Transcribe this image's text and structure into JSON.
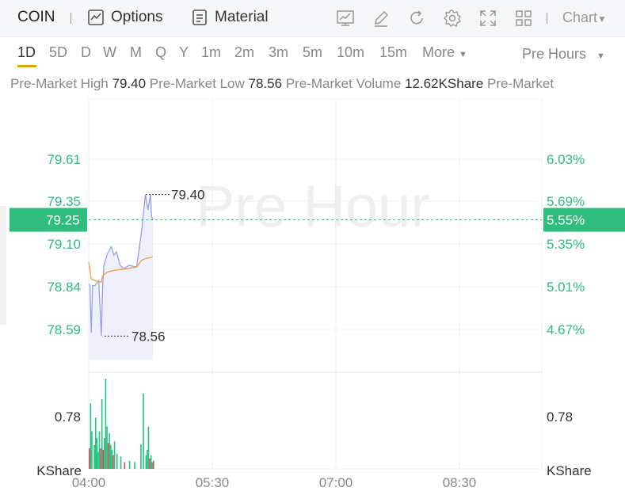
{
  "toolbar": {
    "ticker": "COIN",
    "options_label": "Options",
    "material_label": "Material",
    "chart_select_label": "Chart",
    "icons": [
      "indicator-icon",
      "draw-icon",
      "refresh-icon",
      "settings-icon",
      "fullscreen-icon",
      "layout-icon"
    ]
  },
  "periods": {
    "items": [
      "1D",
      "5D",
      "D",
      "W",
      "M",
      "Q",
      "Y",
      "1m",
      "2m",
      "3m",
      "5m",
      "10m",
      "15m",
      "More"
    ],
    "active": "1D",
    "hours_select": "Pre Hours"
  },
  "stats": [
    {
      "label": "Pre-Market High",
      "value": "79.40"
    },
    {
      "label": "Pre-Market Low",
      "value": "78.56"
    },
    {
      "label": "Pre-Market Volume",
      "value": "12.62KShare"
    },
    {
      "label": "Pre-Market",
      "value": ""
    }
  ],
  "chart_data": {
    "type": "line",
    "watermark": "Pre Hour",
    "x_ticks": [
      "04:00",
      "05:30",
      "07:00",
      "08:30"
    ],
    "price_ticks": [
      "79.61",
      "79.35",
      "79.10",
      "78.84",
      "78.59"
    ],
    "pct_ticks": [
      "6.03%",
      "5.69%",
      "5.35%",
      "5.01%",
      "4.67%"
    ],
    "current_price": "79.25",
    "current_pct": "5.55%",
    "high_label": "79.40",
    "low_label": "78.56",
    "volume_tick": "0.78",
    "volume_unit": "KShare",
    "price_series": [
      {
        "t": "04:00",
        "v": 78.87
      },
      {
        "t": "04:01",
        "v": 78.86
      },
      {
        "t": "04:02",
        "v": 78.58
      },
      {
        "t": "04:03",
        "v": 78.86
      },
      {
        "t": "04:05",
        "v": 78.86
      },
      {
        "t": "04:08",
        "v": 78.89
      },
      {
        "t": "04:10",
        "v": 78.56
      },
      {
        "t": "04:11",
        "v": 78.84
      },
      {
        "t": "04:12",
        "v": 78.98
      },
      {
        "t": "04:15",
        "v": 79.05
      },
      {
        "t": "04:18",
        "v": 79.09
      },
      {
        "t": "04:20",
        "v": 79.04
      },
      {
        "t": "04:22",
        "v": 79.06
      },
      {
        "t": "04:25",
        "v": 78.98
      },
      {
        "t": "04:28",
        "v": 78.96
      },
      {
        "t": "04:32",
        "v": 78.98
      },
      {
        "t": "04:38",
        "v": 78.97
      },
      {
        "t": "04:42",
        "v": 79.18
      },
      {
        "t": "04:45",
        "v": 79.4
      },
      {
        "t": "04:47",
        "v": 79.31
      },
      {
        "t": "04:49",
        "v": 79.4
      },
      {
        "t": "04:50",
        "v": 79.27
      },
      {
        "t": "04:51",
        "v": 79.25
      }
    ],
    "avg_series": [
      {
        "t": "04:00",
        "v": 79.0
      },
      {
        "t": "04:02",
        "v": 78.9
      },
      {
        "t": "04:05",
        "v": 78.89
      },
      {
        "t": "04:10",
        "v": 78.88
      },
      {
        "t": "04:11",
        "v": 78.92
      },
      {
        "t": "04:15",
        "v": 78.94
      },
      {
        "t": "04:20",
        "v": 78.95
      },
      {
        "t": "04:30",
        "v": 78.96
      },
      {
        "t": "04:38",
        "v": 78.97
      },
      {
        "t": "04:42",
        "v": 79.01
      },
      {
        "t": "04:45",
        "v": 79.02
      },
      {
        "t": "04:51",
        "v": 79.03
      }
    ],
    "volume_series": [
      {
        "t": "04:00",
        "v": 0.3,
        "dir": "down"
      },
      {
        "t": "04:01",
        "v": 0.96,
        "dir": "up"
      },
      {
        "t": "04:02",
        "v": 0.55,
        "dir": "up"
      },
      {
        "t": "04:04",
        "v": 0.35,
        "dir": "up"
      },
      {
        "t": "04:05",
        "v": 0.75,
        "dir": "up"
      },
      {
        "t": "04:06",
        "v": 0.45,
        "dir": "up"
      },
      {
        "t": "04:07",
        "v": 0.25,
        "dir": "up"
      },
      {
        "t": "04:08",
        "v": 0.55,
        "dir": "up"
      },
      {
        "t": "04:09",
        "v": 0.3,
        "dir": "down"
      },
      {
        "t": "04:10",
        "v": 1.02,
        "dir": "up"
      },
      {
        "t": "04:11",
        "v": 0.28,
        "dir": "down"
      },
      {
        "t": "04:12",
        "v": 0.45,
        "dir": "up"
      },
      {
        "t": "04:13",
        "v": 1.32,
        "dir": "up"
      },
      {
        "t": "04:14",
        "v": 0.62,
        "dir": "up"
      },
      {
        "t": "04:15",
        "v": 0.38,
        "dir": "down"
      },
      {
        "t": "04:16",
        "v": 0.52,
        "dir": "up"
      },
      {
        "t": "04:17",
        "v": 0.35,
        "dir": "up"
      },
      {
        "t": "04:18",
        "v": 0.28,
        "dir": "up"
      },
      {
        "t": "04:19",
        "v": 0.2,
        "dir": "down"
      },
      {
        "t": "04:20",
        "v": 0.4,
        "dir": "up"
      },
      {
        "t": "04:22",
        "v": 0.22,
        "dir": "up"
      },
      {
        "t": "04:25",
        "v": 0.18,
        "dir": "up"
      },
      {
        "t": "04:28",
        "v": 0.1,
        "dir": "down"
      },
      {
        "t": "04:32",
        "v": 0.12,
        "dir": "up"
      },
      {
        "t": "04:36",
        "v": 0.1,
        "dir": "up"
      },
      {
        "t": "04:41",
        "v": 0.36,
        "dir": "up"
      },
      {
        "t": "04:43",
        "v": 1.1,
        "dir": "up"
      },
      {
        "t": "04:45",
        "v": 0.2,
        "dir": "up"
      },
      {
        "t": "04:46",
        "v": 0.28,
        "dir": "up"
      },
      {
        "t": "04:47",
        "v": 0.62,
        "dir": "up"
      },
      {
        "t": "04:48",
        "v": 0.15,
        "dir": "down"
      },
      {
        "t": "04:49",
        "v": 0.2,
        "dir": "up"
      },
      {
        "t": "04:50",
        "v": 0.1,
        "dir": "up"
      },
      {
        "t": "04:51",
        "v": 0.12,
        "dir": "down"
      }
    ],
    "colors": {
      "price": "#9aa0e6",
      "avg": "#f29a4a",
      "up": "#26c281",
      "down": "#e84a5a",
      "current": "#2ebd7d",
      "axis_text": "#2ebd7d"
    }
  }
}
